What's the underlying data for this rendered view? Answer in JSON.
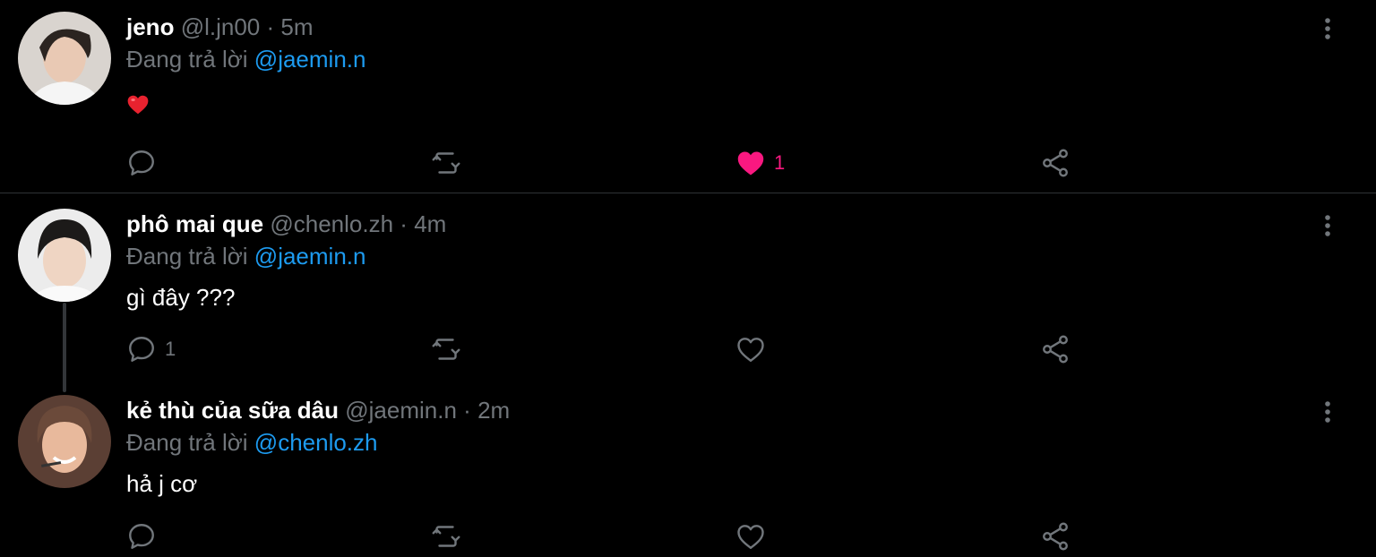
{
  "tweets": [
    {
      "name": "jeno",
      "handle": "@l.jn00",
      "separator": "·",
      "time": "5m",
      "replying_prefix": "Đang trả lời",
      "replying_to": "@jaemin.n",
      "text": "❤️",
      "reply_count": "",
      "like_count": "1",
      "liked": true
    },
    {
      "name": "phô mai que",
      "handle": "@chenlo.zh",
      "separator": "·",
      "time": "4m",
      "replying_prefix": "Đang trả lời",
      "replying_to": "@jaemin.n",
      "text": "gì đây ???",
      "reply_count": "1",
      "like_count": "",
      "liked": false
    },
    {
      "name": "kẻ thù của sữa dâu",
      "handle": "@jaemin.n",
      "separator": "·",
      "time": "2m",
      "replying_prefix": "Đang trả lời",
      "replying_to": "@chenlo.zh",
      "text": "hả j cơ",
      "reply_count": "",
      "like_count": "",
      "liked": false
    }
  ],
  "icons": {
    "reply": "reply-icon",
    "retweet": "retweet-icon",
    "like": "heart-icon",
    "share": "share-icon",
    "more": "more-vertical-icon"
  },
  "colors": {
    "background": "#000000",
    "muted": "#71767b",
    "mention": "#1d9bf0",
    "like": "#f91880"
  }
}
